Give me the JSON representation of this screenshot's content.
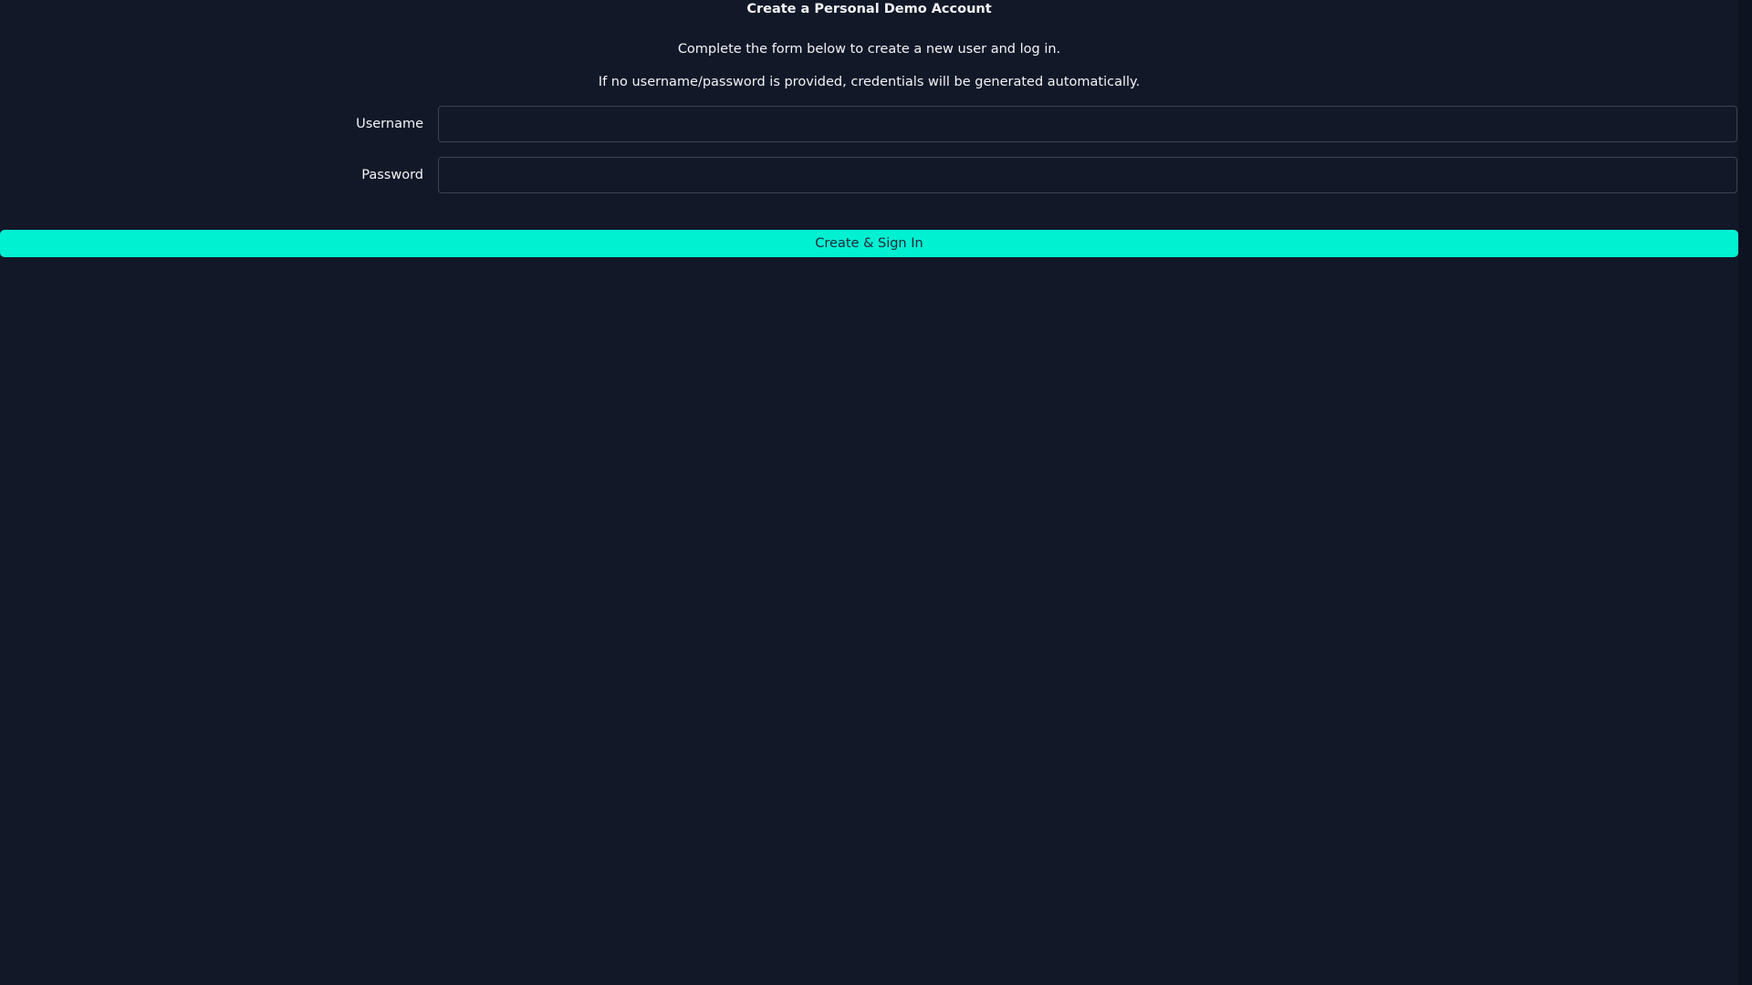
{
  "header": {
    "title": "Create a Personal Demo Account"
  },
  "intro": {
    "line1": "Complete the form below to create a new user and log in.",
    "line2": "If no username/password is provided, credentials will be generated automatically."
  },
  "form": {
    "username": {
      "label": "Username",
      "value": "",
      "placeholder": ""
    },
    "password": {
      "label": "Password",
      "value": "",
      "placeholder": ""
    },
    "submit_label": "Create & Sign In"
  },
  "colors": {
    "background": "#111827",
    "accent": "#00f0d2",
    "text": "#f3f4f6",
    "input_border": "#3b4353"
  }
}
